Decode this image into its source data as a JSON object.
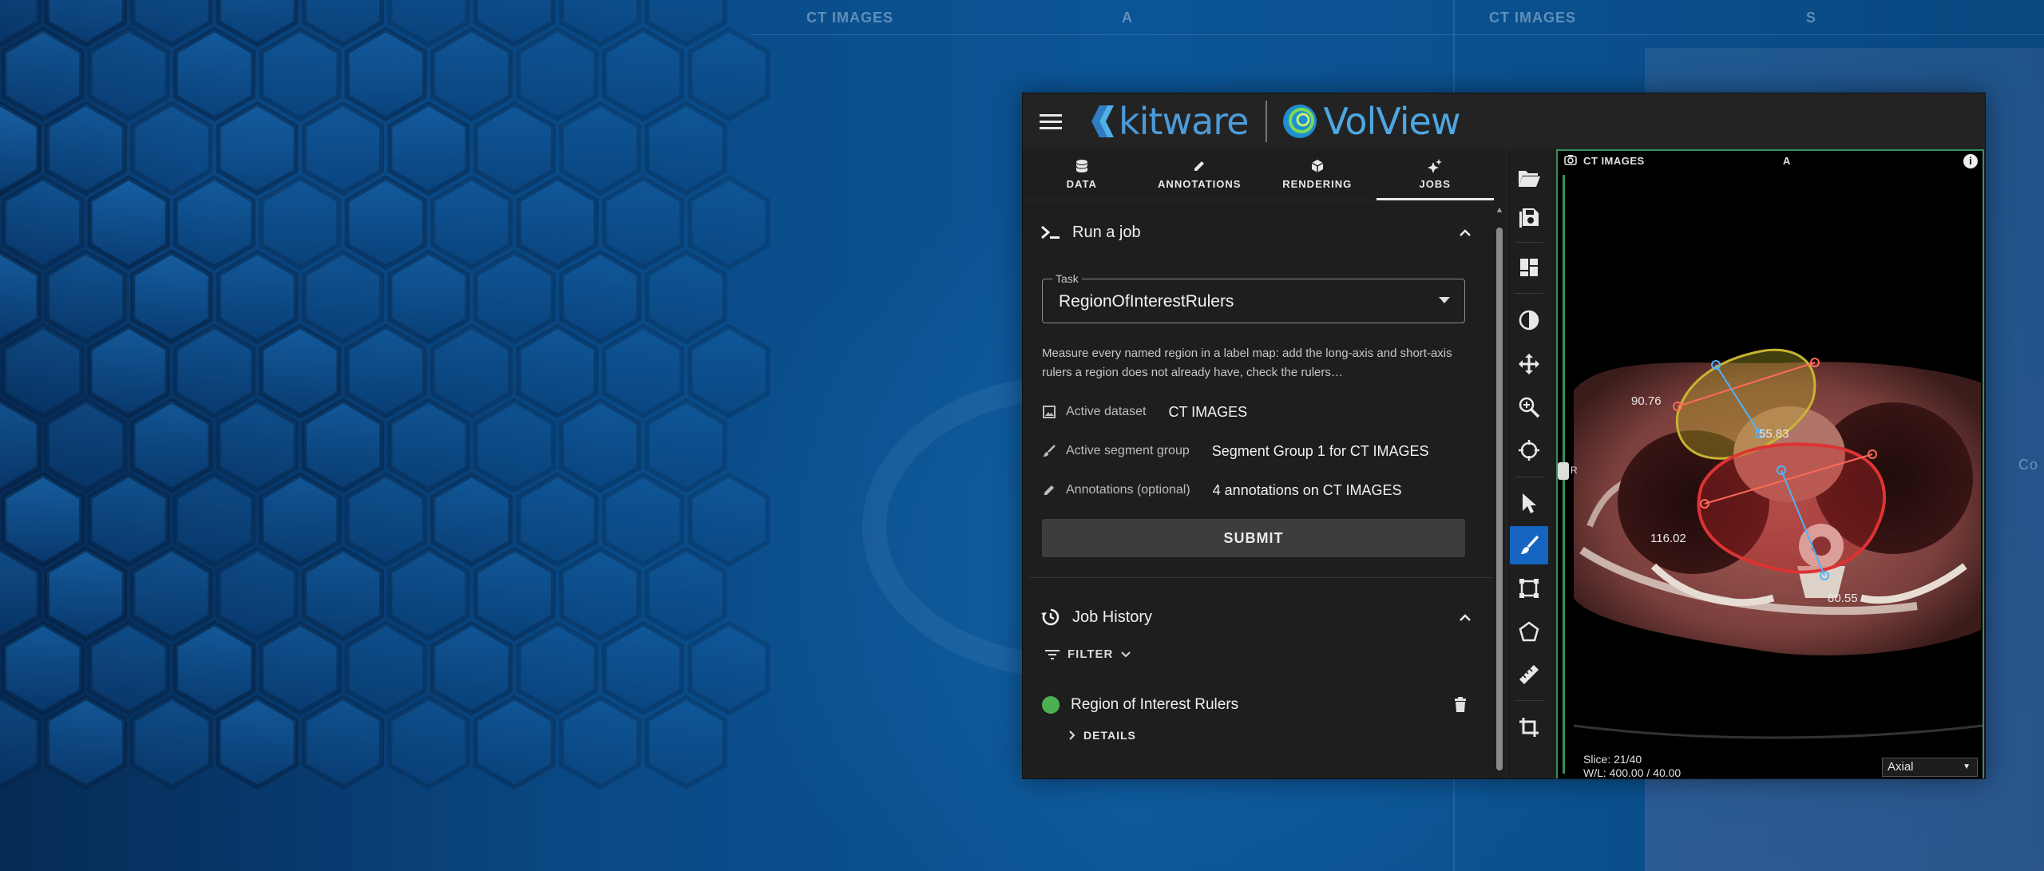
{
  "background": {
    "left_label": "CT IMAGES",
    "left_orient": "A",
    "right_label": "CT IMAGES",
    "right_orient": "S",
    "right_edge_text": "Co"
  },
  "app": {
    "brand_kitware": "kitware",
    "brand_volview": "VolView",
    "tabs": [
      {
        "label": "DATA",
        "icon": "database-icon"
      },
      {
        "label": "ANNOTATIONS",
        "icon": "pencil-icon"
      },
      {
        "label": "RENDERING",
        "icon": "cube-icon"
      },
      {
        "label": "JOBS",
        "icon": "sparkle-icon",
        "active": true
      }
    ],
    "run_job": {
      "title": "Run a job",
      "task_label": "Task",
      "task_value": "RegionOfInterestRulers",
      "description": "Measure every named region in a label map: add the long-axis and short-axis rulers a region does not already have, check the rulers…",
      "active_dataset_label": "Active dataset",
      "active_dataset_value": "CT IMAGES",
      "segment_group_label": "Active segment group",
      "segment_group_value": "Segment Group 1 for CT IMAGES",
      "annotations_label": "Annotations (optional)",
      "annotations_value": "4 annotations on CT IMAGES",
      "submit_label": "SUBMIT"
    },
    "job_history": {
      "title": "Job History",
      "filter_label": "FILTER",
      "jobs": [
        {
          "name": "Region of Interest Rulers",
          "status_color": "#4caf50",
          "details_label": "DETAILS"
        }
      ]
    },
    "tools": [
      "folder-open-icon",
      "save-icon",
      "layout-icon",
      "contrast-icon",
      "pan-icon",
      "zoom-icon",
      "crosshair-icon",
      "select-icon",
      "paint-icon",
      "rectangle-icon",
      "polygon-icon",
      "ruler-icon",
      "crop-icon"
    ],
    "viewer": {
      "name": "CT IMAGES",
      "orientation": "A",
      "side_label": "R",
      "measurements": [
        "90.76",
        "55.83",
        "116.02",
        "80.55"
      ],
      "slice_text": "Slice: 21/40",
      "wl_text": "W/L: 400.00 / 40.00",
      "view_mode": "Axial"
    }
  }
}
